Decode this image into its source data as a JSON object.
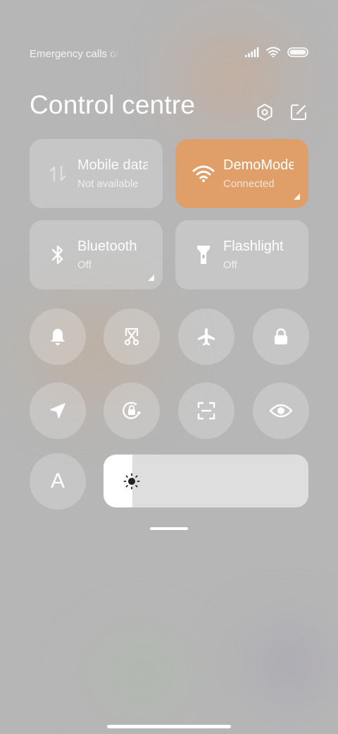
{
  "status_bar": {
    "carrier_text": "Emergency calls only",
    "signal_icon": "signal-bars-icon",
    "wifi_icon": "wifi-icon",
    "battery_icon": "battery-icon"
  },
  "header": {
    "title": "Control centre",
    "settings_icon": "settings-hexagon-icon",
    "edit_icon": "edit-icon"
  },
  "tiles": [
    {
      "name": "mobile-data",
      "label": "Mobile data",
      "status": "Not available",
      "icon": "mobile-data-arrows-icon",
      "active": false,
      "has_corner": false
    },
    {
      "name": "wifi",
      "label": "DemoMode",
      "status": "Connected",
      "icon": "wifi-icon",
      "active": true,
      "has_corner": true
    },
    {
      "name": "bluetooth",
      "label": "Bluetooth",
      "status": "Off",
      "icon": "bluetooth-icon",
      "active": false,
      "has_corner": true
    },
    {
      "name": "flashlight",
      "label": "Flashlight",
      "status": "Off",
      "icon": "flashlight-icon",
      "active": false,
      "has_corner": false
    }
  ],
  "toggles": [
    {
      "name": "ringer",
      "icon": "bell-icon"
    },
    {
      "name": "screenshot",
      "icon": "scissors-screenshot-icon"
    },
    {
      "name": "airplane-mode",
      "icon": "airplane-icon"
    },
    {
      "name": "lock-screen",
      "icon": "lock-icon"
    },
    {
      "name": "location",
      "icon": "location-arrow-icon"
    },
    {
      "name": "rotation-lock",
      "icon": "rotation-lock-icon"
    },
    {
      "name": "scanner",
      "icon": "scan-icon"
    },
    {
      "name": "reading-mode",
      "icon": "eye-icon"
    }
  ],
  "auto_brightness": {
    "label": "A"
  },
  "brightness": {
    "level_percent": 14,
    "icon": "sun-icon"
  },
  "colors": {
    "accent": "#e09e69",
    "background": "#b6b6b6"
  }
}
